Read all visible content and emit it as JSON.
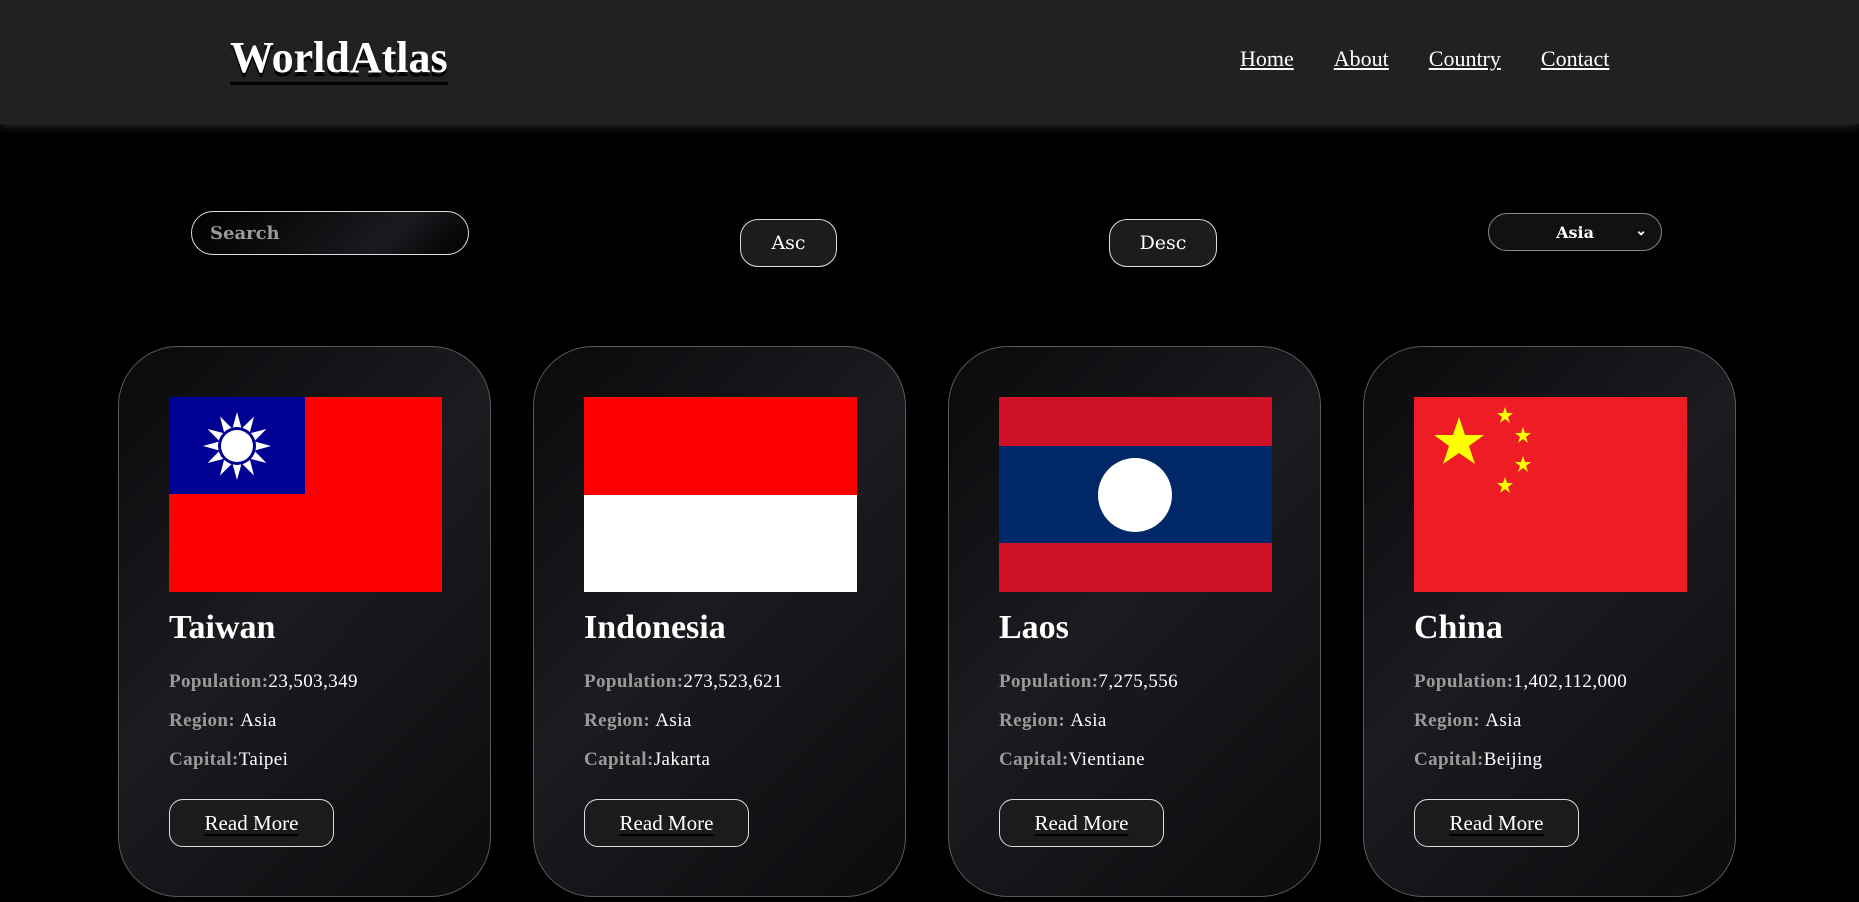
{
  "header": {
    "logo": "WorldAtlas",
    "nav": [
      "Home",
      "About",
      "Country",
      "Contact"
    ]
  },
  "controls": {
    "search_placeholder": "Search",
    "search_value": "",
    "asc_label": "Asc",
    "desc_label": "Desc",
    "region_selected": "Asia"
  },
  "cards": [
    {
      "name": "Taiwan",
      "pop_label": "Population:",
      "population": "23,503,349",
      "region_label": "Region: ",
      "region": "Asia",
      "capital_label": "Capital:",
      "capital": "Taipei",
      "button": "Read More"
    },
    {
      "name": "Indonesia",
      "pop_label": "Population:",
      "population": "273,523,621",
      "region_label": "Region: ",
      "region": "Asia",
      "capital_label": "Capital:",
      "capital": "Jakarta",
      "button": "Read More"
    },
    {
      "name": "Laos",
      "pop_label": "Population:",
      "population": "7,275,556",
      "region_label": "Region: ",
      "region": "Asia",
      "capital_label": "Capital:",
      "capital": "Vientiane",
      "button": "Read More"
    },
    {
      "name": "China",
      "pop_label": "Population:",
      "population": "1,402,112,000",
      "region_label": "Region: ",
      "region": "Asia",
      "capital_label": "Capital:",
      "capital": "Beijing",
      "button": "Read More"
    }
  ],
  "colors": {
    "taiwan_red": "#fe0000",
    "taiwan_blue": "#000095",
    "indonesia_red": "#ff0000",
    "laos_red": "#ce1126",
    "laos_blue": "#002868",
    "china_red": "#ee1c25",
    "china_yellow": "#ffff00"
  }
}
